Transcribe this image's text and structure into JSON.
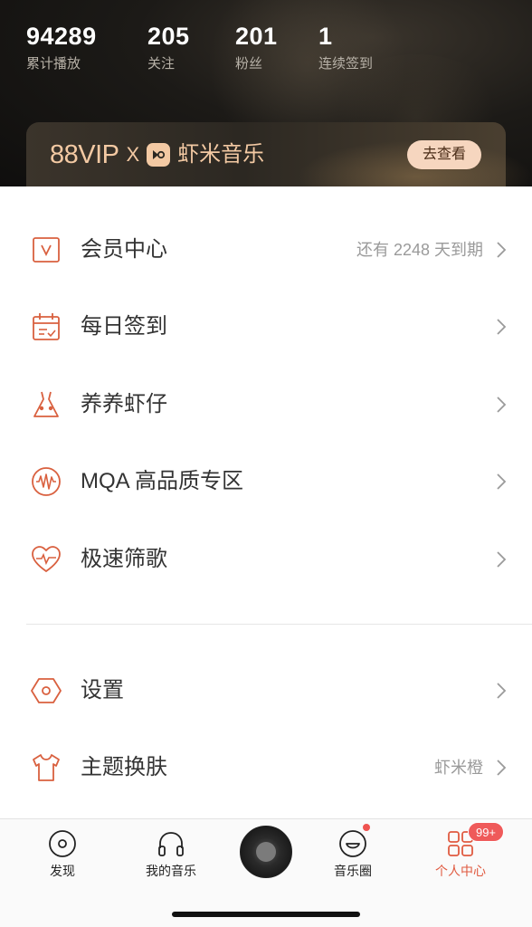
{
  "stats": [
    {
      "value": "94289",
      "label": "累计播放"
    },
    {
      "value": "205",
      "label": "关注"
    },
    {
      "value": "201",
      "label": "粉丝"
    },
    {
      "value": "1",
      "label": "连续签到"
    }
  ],
  "vip_banner": {
    "left_text": "88VIP",
    "x_text": "X",
    "brand_text": "虾米音乐",
    "button_label": "去查看"
  },
  "menu": [
    {
      "label": "会员中心",
      "meta": "还有 2248 天到期",
      "icon": "vip-card-icon"
    },
    {
      "label": "每日签到",
      "meta": "",
      "icon": "calendar-icon"
    },
    {
      "label": "养养虾仔",
      "meta": "",
      "icon": "shrimp-pet-icon"
    },
    {
      "label": "MQA 高品质专区",
      "meta": "",
      "icon": "waveform-icon"
    },
    {
      "label": "极速筛歌",
      "meta": "",
      "icon": "heart-pulse-icon"
    },
    {
      "label": "设置",
      "meta": "",
      "icon": "settings-hexagon-icon"
    },
    {
      "label": "主题换肤",
      "meta": "虾米橙",
      "icon": "tshirt-icon"
    }
  ],
  "tabbar": {
    "tabs": [
      {
        "label": "发现",
        "icon": "disc-icon"
      },
      {
        "label": "我的音乐",
        "icon": "headphones-icon"
      },
      {
        "label": "音乐圈",
        "icon": "smile-icon"
      },
      {
        "label": "个人中心",
        "icon": "grid-icon"
      }
    ],
    "badge_count": "99+"
  },
  "colors": {
    "accent": "#e05a40",
    "icon_accent": "#d9603f",
    "vip_gold": "#f3c9a3",
    "header_bg": "#1c1a17",
    "badge_red": "#ef5a5a"
  }
}
